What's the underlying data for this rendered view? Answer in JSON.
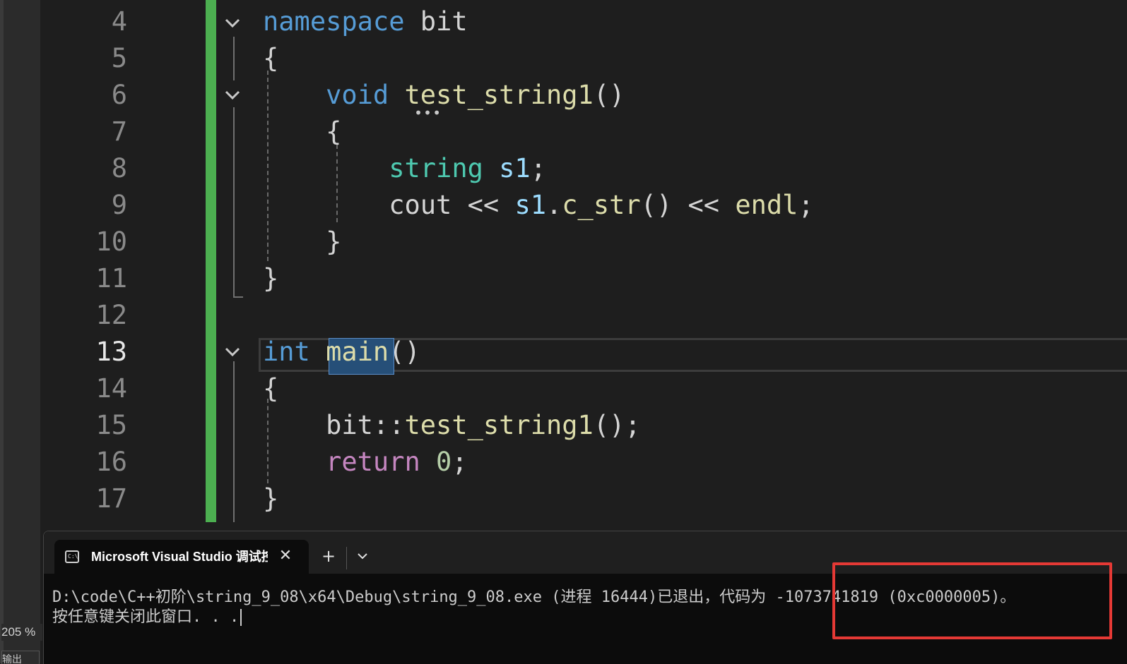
{
  "editor": {
    "zoom": "205 %",
    "output_tab": "输出",
    "line_numbers": [
      "4",
      "5",
      "6",
      "7",
      "8",
      "9",
      "10",
      "11",
      "12",
      "13",
      "14",
      "15",
      "16",
      "17"
    ],
    "current_line": "13",
    "code": {
      "l4": {
        "kw": "namespace",
        "name": "bit"
      },
      "l5": {
        "text": "{"
      },
      "l6": {
        "kw": "void",
        "fn": "test_string1",
        "rest": "()"
      },
      "l7": {
        "text": "{"
      },
      "l8": {
        "type": "string",
        "var": "s1",
        "rest": ";"
      },
      "l9": {
        "a": "cout << ",
        "var": "s1",
        "b": ".",
        "fn": "c_str",
        "c": "() << ",
        "fn2": "endl",
        "d": ";"
      },
      "l10": {
        "text": "}"
      },
      "l11": {
        "text": "}"
      },
      "l13": {
        "kw": "int",
        "fn": "main",
        "rest": "()"
      },
      "l14": {
        "text": "{"
      },
      "l15": {
        "ns": "bit::",
        "fn": "test_string1",
        "rest": "();"
      },
      "l16": {
        "kw": "return",
        "num": "0",
        "rest": ";"
      },
      "l17": {
        "text": "}"
      }
    },
    "colors": {
      "keyword": "#569cd6",
      "type": "#4ec9b0",
      "function": "#dcdcaa",
      "variable": "#9cdcfe",
      "control": "#c586c0",
      "number": "#b5cea8",
      "change_bar": "#4caf50"
    }
  },
  "terminal": {
    "tab_title": "Microsoft Visual Studio 调试控",
    "tab_icon": "console-icon",
    "close_icon": "close-icon",
    "new_tab_icon": "plus-icon",
    "dropdown_icon": "chevron-down-icon",
    "line1": "D:\\code\\C++初阶\\string_9_08\\x64\\Debug\\string_9_08.exe (进程 16444)已退出，代码为 -1073741819 (0xc0000005)。",
    "line2": "按任意键关闭此窗口. . .",
    "highlight_color": "#e53935"
  }
}
